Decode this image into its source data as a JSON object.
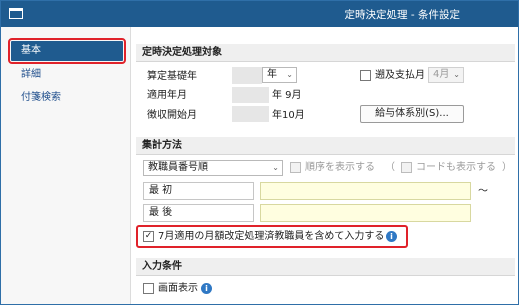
{
  "window": {
    "title": "定時決定処理 - 条件設定"
  },
  "sidebar": {
    "items": [
      {
        "label": "基本"
      },
      {
        "label": "詳細"
      },
      {
        "label": "付箋検索"
      }
    ]
  },
  "sections": {
    "target": {
      "heading": "定時決定処理対象",
      "base_year_label": "算定基礎年",
      "base_year_unit": "年",
      "retro_label": "遡及支払月",
      "retro_value": "4月",
      "applied_label": "適用年月",
      "applied_value": "年  9月",
      "collection_label": "徴収開始月",
      "collection_value": "年10月",
      "salary_button": "給与体系別(S)..."
    },
    "aggregation": {
      "heading": "集計方法",
      "order_value": "教職員番号順",
      "show_order_label": "順序を表示する",
      "paren_open": "（",
      "show_code_label": "コードも表示する",
      "paren_close": "）",
      "first_label": "最 初",
      "last_label": "最 後",
      "tilde": "～",
      "july_check_mark": "✓",
      "july_label": "7月適用の月額改定処理済教職員を含めて入力する"
    },
    "input": {
      "heading": "入力条件",
      "screen_display_label": "画面表示"
    }
  },
  "icons": {
    "info_glyph": "i"
  }
}
